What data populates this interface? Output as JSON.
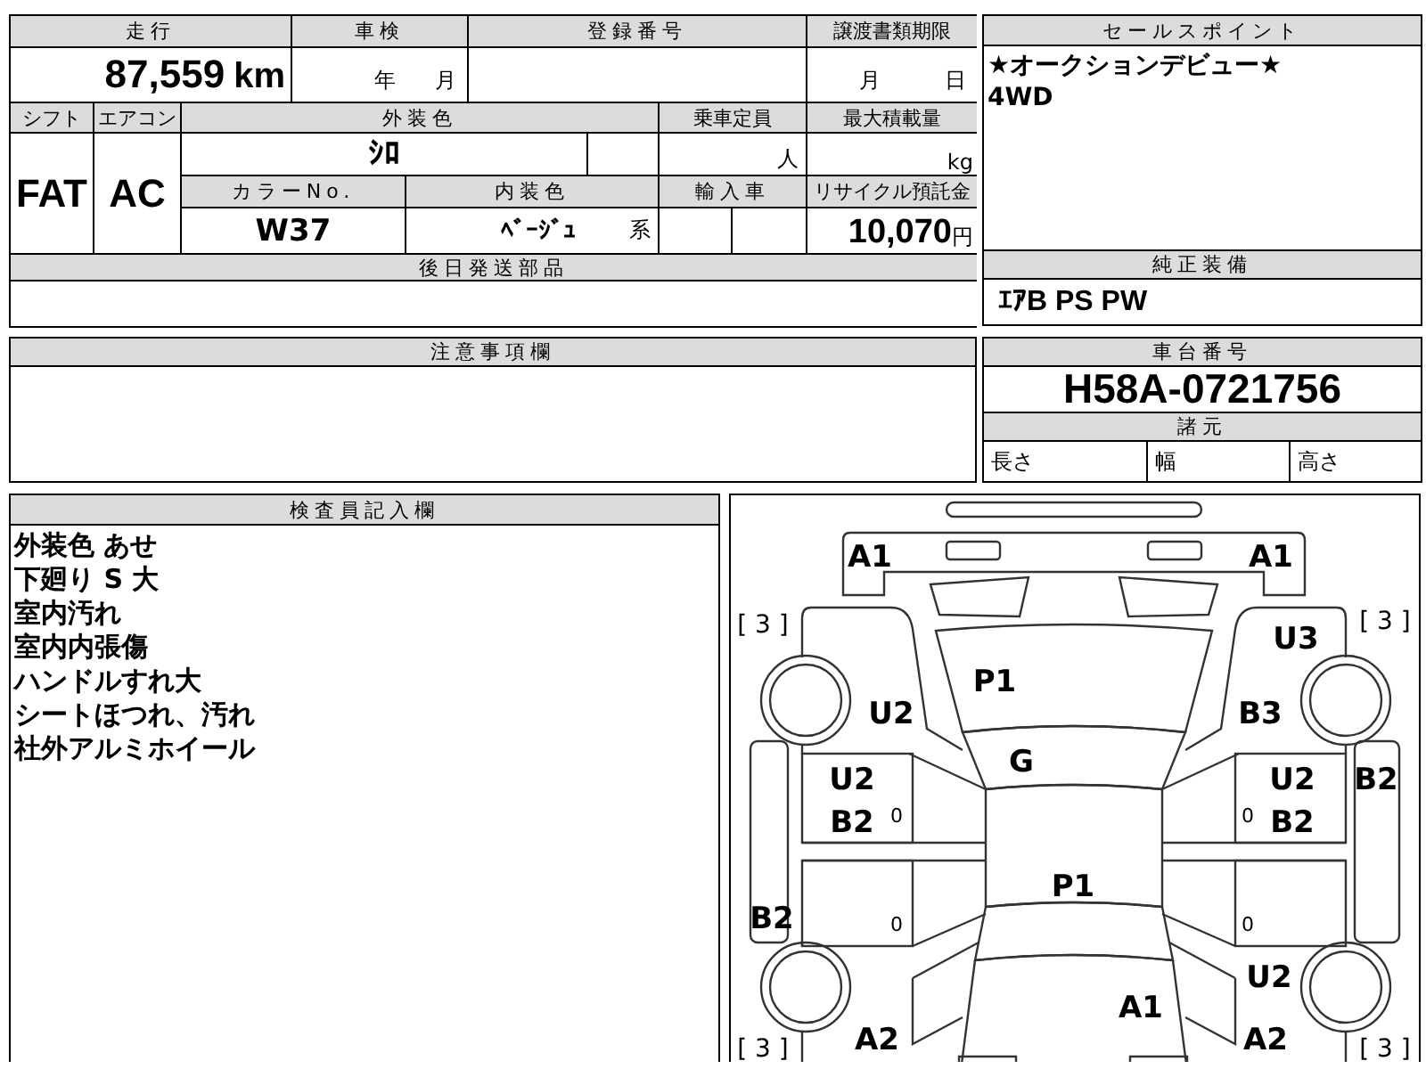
{
  "mileage": {
    "label": "走行",
    "value": "87,559",
    "unit": "km"
  },
  "inspection": {
    "label": "車検",
    "year_unit": "年",
    "month_unit": "月"
  },
  "registration_number": {
    "label": "登録番号"
  },
  "transfer_deadline": {
    "label": "譲渡書類期限",
    "month_unit": "月",
    "day_unit": "日"
  },
  "shift": {
    "label": "シフト",
    "value": "FAT"
  },
  "air_conditioner": {
    "label": "エアコン",
    "value": "AC"
  },
  "exterior_color": {
    "label": "外装色",
    "value": "ｼﾛ"
  },
  "capacity": {
    "label": "乗車定員",
    "unit": "人"
  },
  "max_load": {
    "label": "最大積載量",
    "unit": "kg"
  },
  "color_number": {
    "label": "カラーNo.",
    "value": "W37"
  },
  "interior_color": {
    "label": "内装色",
    "value": "ﾍﾞｰｼﾞｭ",
    "suffix": "系"
  },
  "imported": {
    "label": "輸入車"
  },
  "recycling_deposit": {
    "label": "リサイクル預託金",
    "value": "10,070",
    "unit": "円"
  },
  "later_shipment_parts": {
    "label": "後日発送部品"
  },
  "sales_points": {
    "label": "セールスポイント",
    "lines": [
      "★オークションデビュー★",
      "4WD"
    ]
  },
  "standard_equipment": {
    "label": "純正装備",
    "value": "ｴｱB PS PW"
  },
  "notes": {
    "label": "注意事項欄"
  },
  "chassis_number": {
    "label": "車台番号",
    "value": "H58A-0721756"
  },
  "specifications": {
    "label": "諸元",
    "items": [
      "長さ",
      "幅",
      "高さ"
    ]
  },
  "inspector_remarks": {
    "label": "検査員記入欄",
    "lines": [
      "外装色 あせ",
      "下廻り S 大",
      "室内汚れ",
      "室内内張傷",
      "ハンドルすれ大",
      "シートほつれ、汚れ",
      "社外アルミホイール"
    ]
  },
  "damage_diagram": {
    "marks": [
      {
        "kind": "code",
        "text": "A1"
      },
      {
        "kind": "code",
        "text": "A1"
      },
      {
        "kind": "tire",
        "text": "[ 3 ]"
      },
      {
        "kind": "tire",
        "text": "[ 3 ]"
      },
      {
        "kind": "code",
        "text": "U3"
      },
      {
        "kind": "code",
        "text": "P1"
      },
      {
        "kind": "code",
        "text": "U2"
      },
      {
        "kind": "code",
        "text": "B3"
      },
      {
        "kind": "code",
        "text": "G"
      },
      {
        "kind": "code",
        "text": "U2"
      },
      {
        "kind": "code",
        "text": "U2"
      },
      {
        "kind": "code",
        "text": "B2"
      },
      {
        "kind": "code",
        "text": "B2"
      },
      {
        "kind": "small",
        "text": "0"
      },
      {
        "kind": "small",
        "text": "0"
      },
      {
        "kind": "code",
        "text": "B2"
      },
      {
        "kind": "code",
        "text": "P1"
      },
      {
        "kind": "code",
        "text": "B2"
      },
      {
        "kind": "small",
        "text": "0"
      },
      {
        "kind": "small",
        "text": "0"
      },
      {
        "kind": "code",
        "text": "U2"
      },
      {
        "kind": "code",
        "text": "A1"
      },
      {
        "kind": "code",
        "text": "A2"
      },
      {
        "kind": "code",
        "text": "A2"
      },
      {
        "kind": "tire",
        "text": "[ 3 ]"
      },
      {
        "kind": "tire",
        "text": "[ 3 ]"
      }
    ]
  }
}
